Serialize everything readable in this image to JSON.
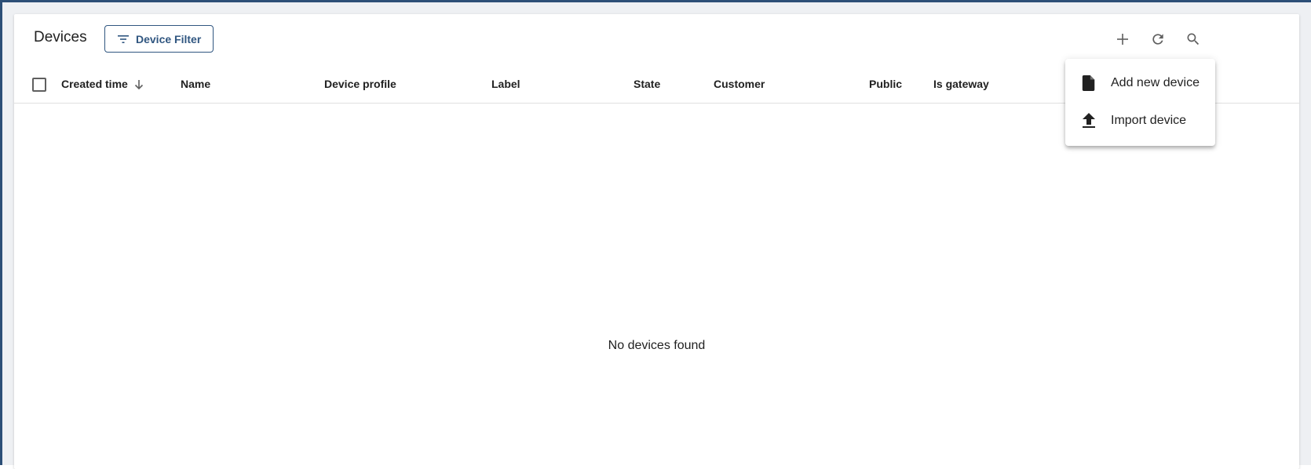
{
  "toolbar": {
    "title": "Devices",
    "filter_label": "Device Filter",
    "icons": [
      "filter-icon",
      "add-icon",
      "refresh-icon",
      "search-icon"
    ]
  },
  "table": {
    "columns": [
      {
        "label": "Created time",
        "sorted": "descending"
      },
      {
        "label": "Name"
      },
      {
        "label": "Device profile"
      },
      {
        "label": "Label"
      },
      {
        "label": "State"
      },
      {
        "label": "Customer"
      },
      {
        "label": "Public"
      },
      {
        "label": "Is gateway"
      }
    ],
    "empty_message": "No devices found"
  },
  "add_menu": {
    "items": [
      {
        "label": "Add new device",
        "icon": "file-icon"
      },
      {
        "label": "Import device",
        "icon": "upload-icon"
      }
    ]
  },
  "colors": {
    "accent": "#305680",
    "frame_edge": "#2c4f77",
    "icon": "#5f5f5f"
  }
}
